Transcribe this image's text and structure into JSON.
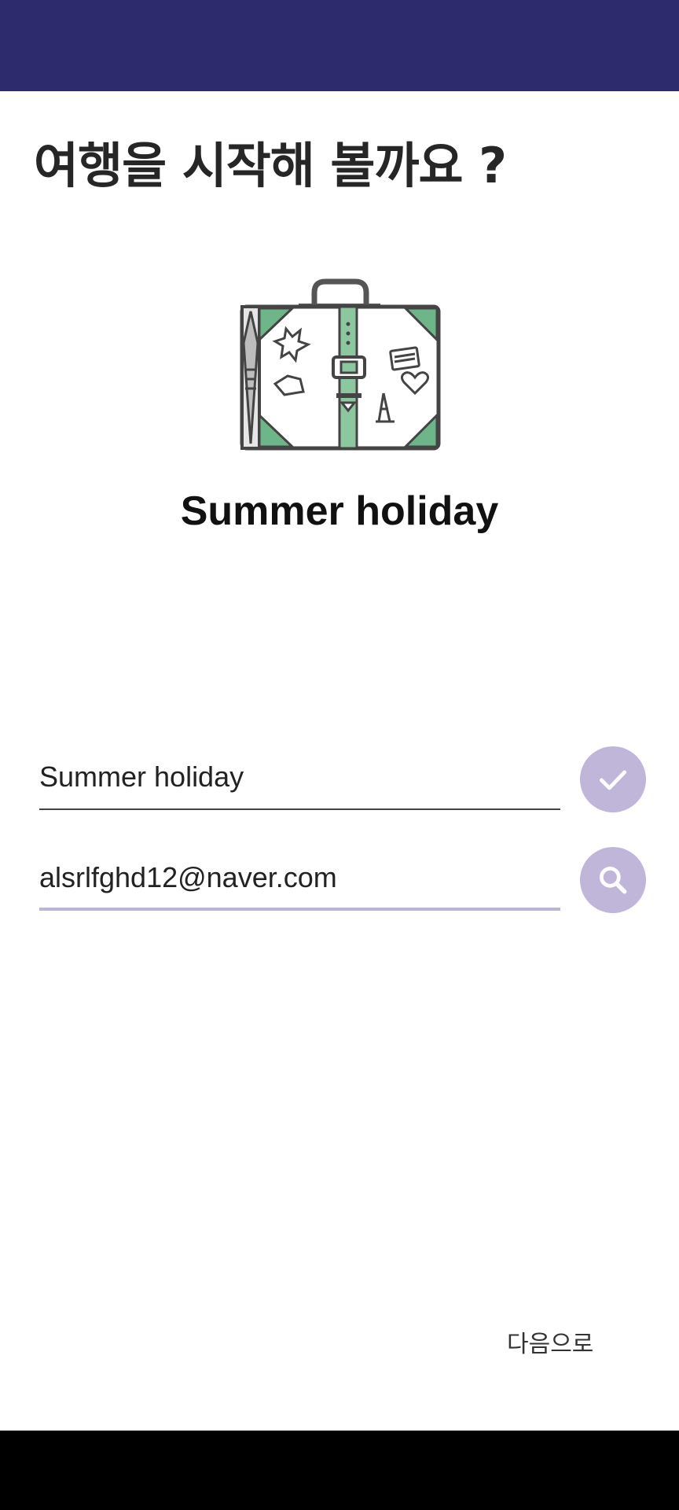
{
  "header": {
    "title": "여행을 시작해 볼까요 ?"
  },
  "illustration": {
    "icon": "suitcase-icon"
  },
  "trip": {
    "name": "Summer holiday"
  },
  "form": {
    "trip_name_value": "Summer holiday",
    "email_value": "alsrlfghd12@naver.com",
    "confirm_icon": "check-icon",
    "search_icon": "search-icon"
  },
  "footer": {
    "next_label": "다음으로"
  },
  "colors": {
    "status_bar": "#2e2a6e",
    "accent": "#c0b6d9",
    "suitcase_green": "#6fb58a"
  }
}
